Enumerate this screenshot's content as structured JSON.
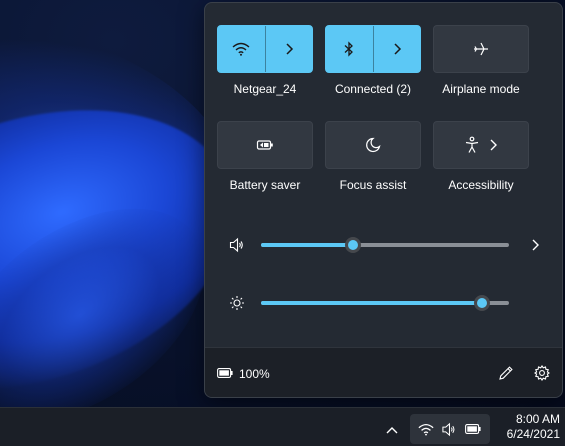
{
  "quick_settings": {
    "tiles": [
      {
        "label": "Netgear_24",
        "icon": "wifi-icon",
        "active": true,
        "split": true
      },
      {
        "label": "Connected (2)",
        "icon": "bluetooth-icon",
        "active": true,
        "split": true
      },
      {
        "label": "Airplane mode",
        "icon": "airplane-icon",
        "active": false,
        "split": false
      },
      {
        "label": "Battery saver",
        "icon": "battery-saver-icon",
        "active": false,
        "split": false
      },
      {
        "label": "Focus assist",
        "icon": "moon-icon",
        "active": false,
        "split": false
      },
      {
        "label": "Accessibility",
        "icon": "accessibility-icon",
        "active": false,
        "split": false
      }
    ],
    "volume": {
      "icon": "speaker-icon",
      "level": 0.37
    },
    "brightness": {
      "icon": "sun-icon",
      "level": 0.89
    },
    "battery_percent": "100%"
  },
  "taskbar": {
    "time": "8:00 AM",
    "date": "6/24/2021"
  },
  "colors": {
    "accent": "#5cc8f5",
    "panel": "#242a33",
    "tile_off": "#323841",
    "footer": "#1c2027"
  }
}
